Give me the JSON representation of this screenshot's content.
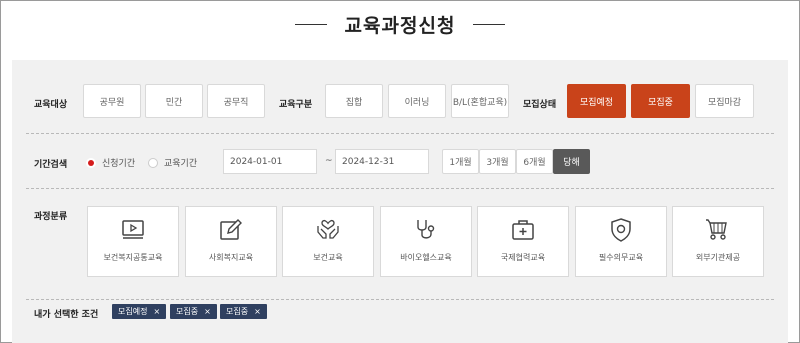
{
  "page": {
    "title": "교육과정신청"
  },
  "filters": {
    "target": {
      "label": "교육대상",
      "options": [
        "공무원",
        "민간",
        "공무직"
      ]
    },
    "category": {
      "label": "교육구분",
      "options": [
        "집합",
        "이러닝",
        "B/L(혼합교육)"
      ]
    },
    "status": {
      "label": "모집상태",
      "options": [
        {
          "label": "모집예정",
          "active": true
        },
        {
          "label": "모집중",
          "active": true
        },
        {
          "label": "모집마감",
          "active": false
        }
      ]
    }
  },
  "period": {
    "label": "기간검색",
    "radios": [
      {
        "label": "신청기간",
        "checked": true
      },
      {
        "label": "교육기간",
        "checked": false
      }
    ],
    "start_date": "2024-01-01",
    "separator": "~",
    "end_date": "2024-12-31",
    "quick": [
      "1개월",
      "3개월",
      "6개월",
      "당해"
    ]
  },
  "courses": {
    "label": "과정분류",
    "items": [
      {
        "label": "보건복지공통교육",
        "icon": "video-play-icon"
      },
      {
        "label": "사회복지교육",
        "icon": "edit-icon"
      },
      {
        "label": "보건교육",
        "icon": "hands-heart-icon"
      },
      {
        "label": "바이오헬스교육",
        "icon": "stethoscope-icon"
      },
      {
        "label": "국제협력교육",
        "icon": "first-aid-kit-icon"
      },
      {
        "label": "필수의무교육",
        "icon": "shield-icon"
      },
      {
        "label": "외부기관제공",
        "icon": "stroller-icon"
      }
    ]
  },
  "selected": {
    "label": "내가 선택한 조건",
    "tags": [
      "모집예정",
      "모집중",
      "모집중"
    ],
    "remove_glyph": "×"
  },
  "colors": {
    "accent": "#c9431a",
    "tag": "#2f4060",
    "panel": "#f1f1f1",
    "radio_on": "#d51c1c"
  }
}
